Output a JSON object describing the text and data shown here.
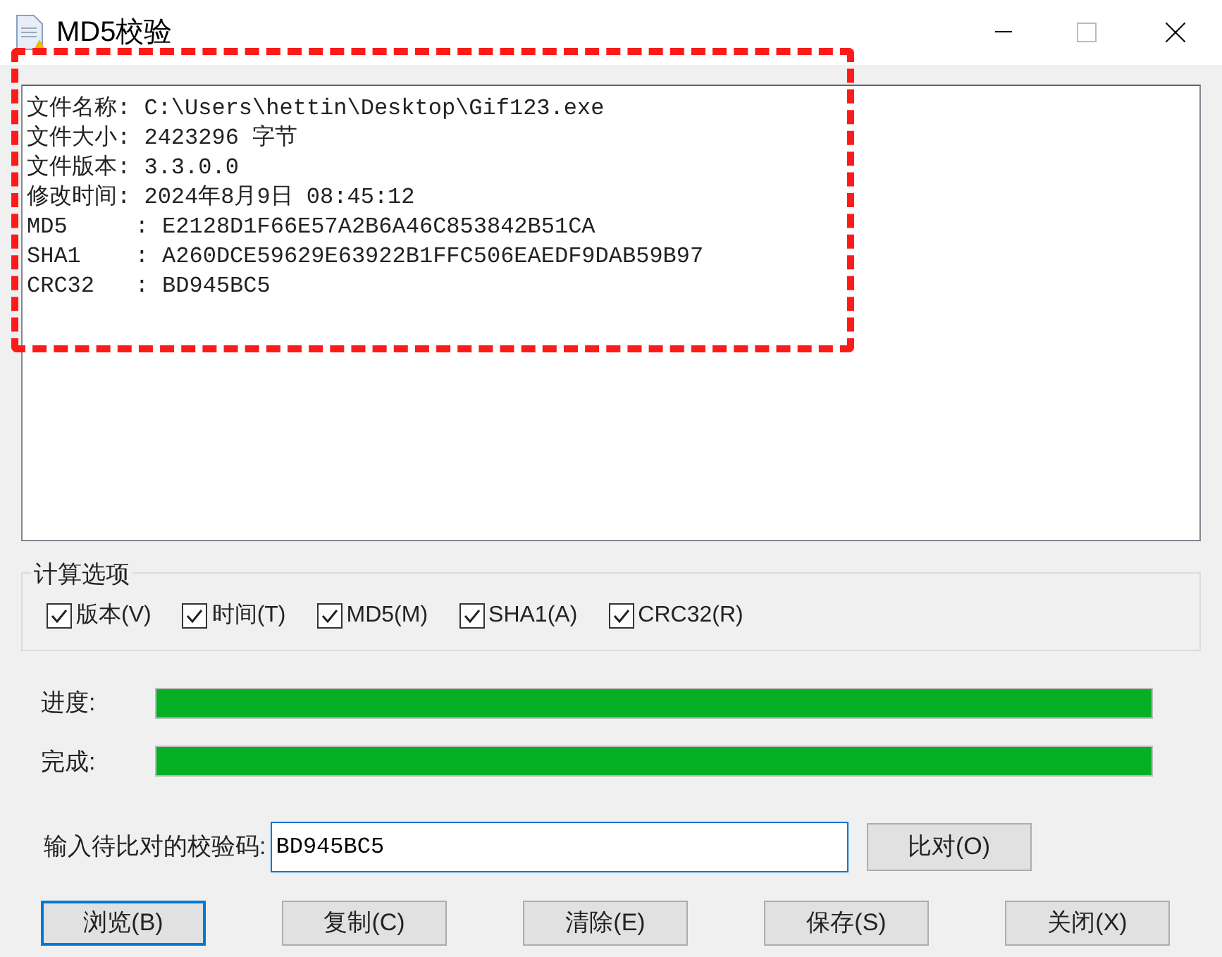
{
  "window": {
    "title": "MD5校验"
  },
  "output_lines": [
    {
      "label": "文件名称:",
      "value": "C:\\Users\\hettin\\Desktop\\Gif123.exe"
    },
    {
      "label": "文件大小:",
      "value": "2423296 字节"
    },
    {
      "label": "文件版本:",
      "value": "3.3.0.0"
    },
    {
      "label": "修改时间:",
      "value": "2024年8月9日 08:45:12"
    },
    {
      "label": "MD5     :",
      "value": "E2128D1F66E57A2B6A46C853842B51CA"
    },
    {
      "label": "SHA1    :",
      "value": "A260DCE59629E63922B1FFC506EAEDF9DAB59B97"
    },
    {
      "label": "CRC32   :",
      "value": "BD945BC5"
    }
  ],
  "highlight": {
    "shown": true
  },
  "options": {
    "title": "计算选项",
    "items": [
      {
        "label": "版本(V)",
        "checked": true
      },
      {
        "label": "时间(T)",
        "checked": true
      },
      {
        "label": "MD5(M)",
        "checked": true
      },
      {
        "label": "SHA1(A)",
        "checked": true
      },
      {
        "label": "CRC32(R)",
        "checked": true
      }
    ]
  },
  "progress": [
    {
      "label": "进度:",
      "level": 1
    },
    {
      "label": "完成:",
      "level": 1
    }
  ],
  "compare": {
    "label": "输入待比对的校验码:",
    "value": "BD945BC5",
    "button": "比对(O)"
  },
  "buttons": [
    {
      "label": "浏览(B)",
      "default": true
    },
    {
      "label": "复制(C)",
      "default": false
    },
    {
      "label": "清除(E)",
      "default": false
    },
    {
      "label": "保存(S)",
      "default": false
    },
    {
      "label": "关闭(X)",
      "default": false
    }
  ]
}
